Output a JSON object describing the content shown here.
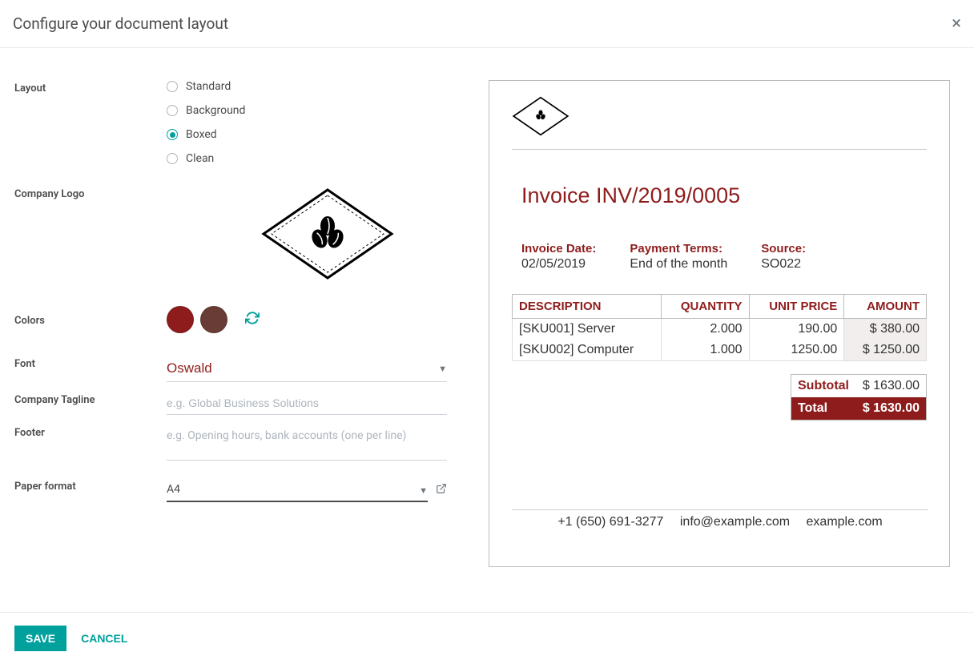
{
  "modal": {
    "title": "Configure your document layout"
  },
  "form": {
    "layout_label": "Layout",
    "layout_options": {
      "standard": "Standard",
      "background": "Background",
      "boxed": "Boxed",
      "clean": "Clean"
    },
    "layout_selected": "Boxed",
    "company_logo_label": "Company Logo",
    "colors_label": "Colors",
    "colors": {
      "primary": "#8f1c1c",
      "secondary": "#6a3c36"
    },
    "font_label": "Font",
    "font_value": "Oswald",
    "tagline_label": "Company Tagline",
    "tagline_placeholder": "e.g. Global Business Solutions",
    "footer_label": "Footer",
    "footer_placeholder": "e.g. Opening hours, bank accounts (one per line)",
    "paper_label": "Paper format",
    "paper_value": "A4"
  },
  "preview": {
    "title": "Invoice INV/2019/0005",
    "meta": {
      "date_label": "Invoice Date:",
      "date_value": "02/05/2019",
      "terms_label": "Payment Terms:",
      "terms_value": "End of the month",
      "source_label": "Source:",
      "source_value": "SO022"
    },
    "table": {
      "headers": {
        "desc": "DESCRIPTION",
        "qty": "QUANTITY",
        "price": "UNIT PRICE",
        "amount": "AMOUNT"
      },
      "rows": [
        {
          "desc": "[SKU001] Server",
          "qty": "2.000",
          "price": "190.00",
          "amount": "$ 380.00"
        },
        {
          "desc": "[SKU002] Computer",
          "qty": "1.000",
          "price": "1250.00",
          "amount": "$ 1250.00"
        }
      ]
    },
    "totals": {
      "subtotal_label": "Subtotal",
      "subtotal_value": "$ 1630.00",
      "total_label": "Total",
      "total_value": "$ 1630.00"
    },
    "footer": {
      "phone": "+1 (650) 691-3277",
      "email": "info@example.com",
      "web": "example.com"
    }
  },
  "buttons": {
    "save": "SAVE",
    "cancel": "CANCEL"
  }
}
